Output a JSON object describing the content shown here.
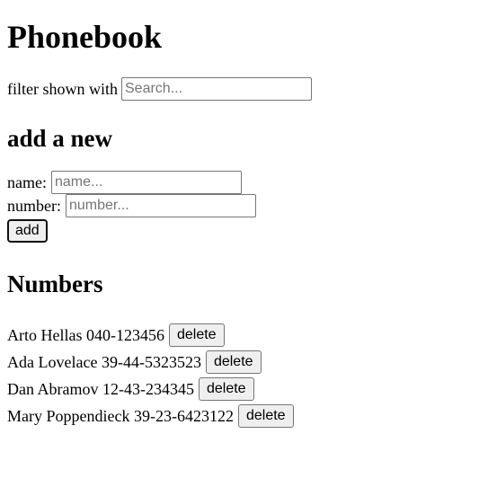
{
  "header": {
    "title": "Phonebook"
  },
  "filter": {
    "label": "filter shown with",
    "placeholder": "Search...",
    "value": ""
  },
  "add_form": {
    "heading": "add a new",
    "name_label": "name:",
    "name_placeholder": "name...",
    "number_label": "number:",
    "number_placeholder": "number...",
    "add_label": "add"
  },
  "numbers": {
    "heading": "Numbers",
    "delete_label": "delete",
    "entries": [
      {
        "name": "Arto Hellas",
        "number": "040-123456"
      },
      {
        "name": "Ada Lovelace",
        "number": "39-44-5323523"
      },
      {
        "name": "Dan Abramov",
        "number": "12-43-234345"
      },
      {
        "name": "Mary Poppendieck",
        "number": "39-23-6423122"
      }
    ]
  }
}
